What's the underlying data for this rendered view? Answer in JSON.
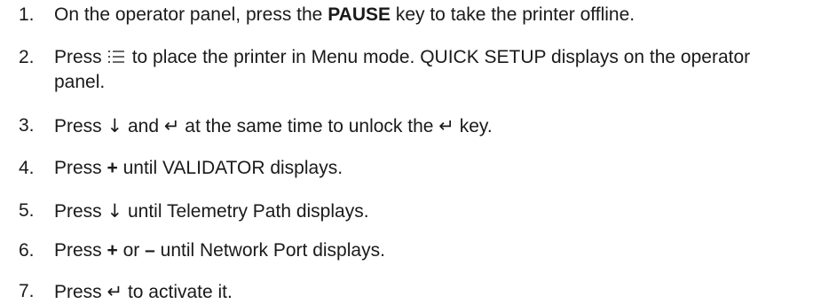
{
  "steps": [
    {
      "number": "1.",
      "before": "On the operator panel, press the ",
      "bold": "PAUSE",
      "after": " key to take the printer offline."
    },
    {
      "number": "2.",
      "before": "Press",
      "icon": "menu-list-icon",
      "after": "to place the printer in Menu mode. QUICK SETUP displays on the operator panel."
    },
    {
      "number": "3.",
      "t1": "Press ",
      "down": "↓",
      "t2": " and ",
      "enter1": "↵",
      "t3": " at the same time to unlock the ",
      "enter2": "↵",
      "t4": " key."
    },
    {
      "number": "4.",
      "before": "Press ",
      "bold": "+",
      "after": " until VALIDATOR displays."
    },
    {
      "number": "5.",
      "before": "Press ",
      "down": "↓",
      "after": " until Telemetry Path displays."
    },
    {
      "number": "6.",
      "t1": "Press ",
      "plus": "+",
      "t2": " or ",
      "minus": "–",
      "t3": " until Network Port displays."
    },
    {
      "number": "7.",
      "before": "Press ",
      "enter": "↵",
      "after": " to activate it."
    }
  ],
  "colors": {
    "text": "#1a1a1a",
    "background": "#ffffff"
  }
}
